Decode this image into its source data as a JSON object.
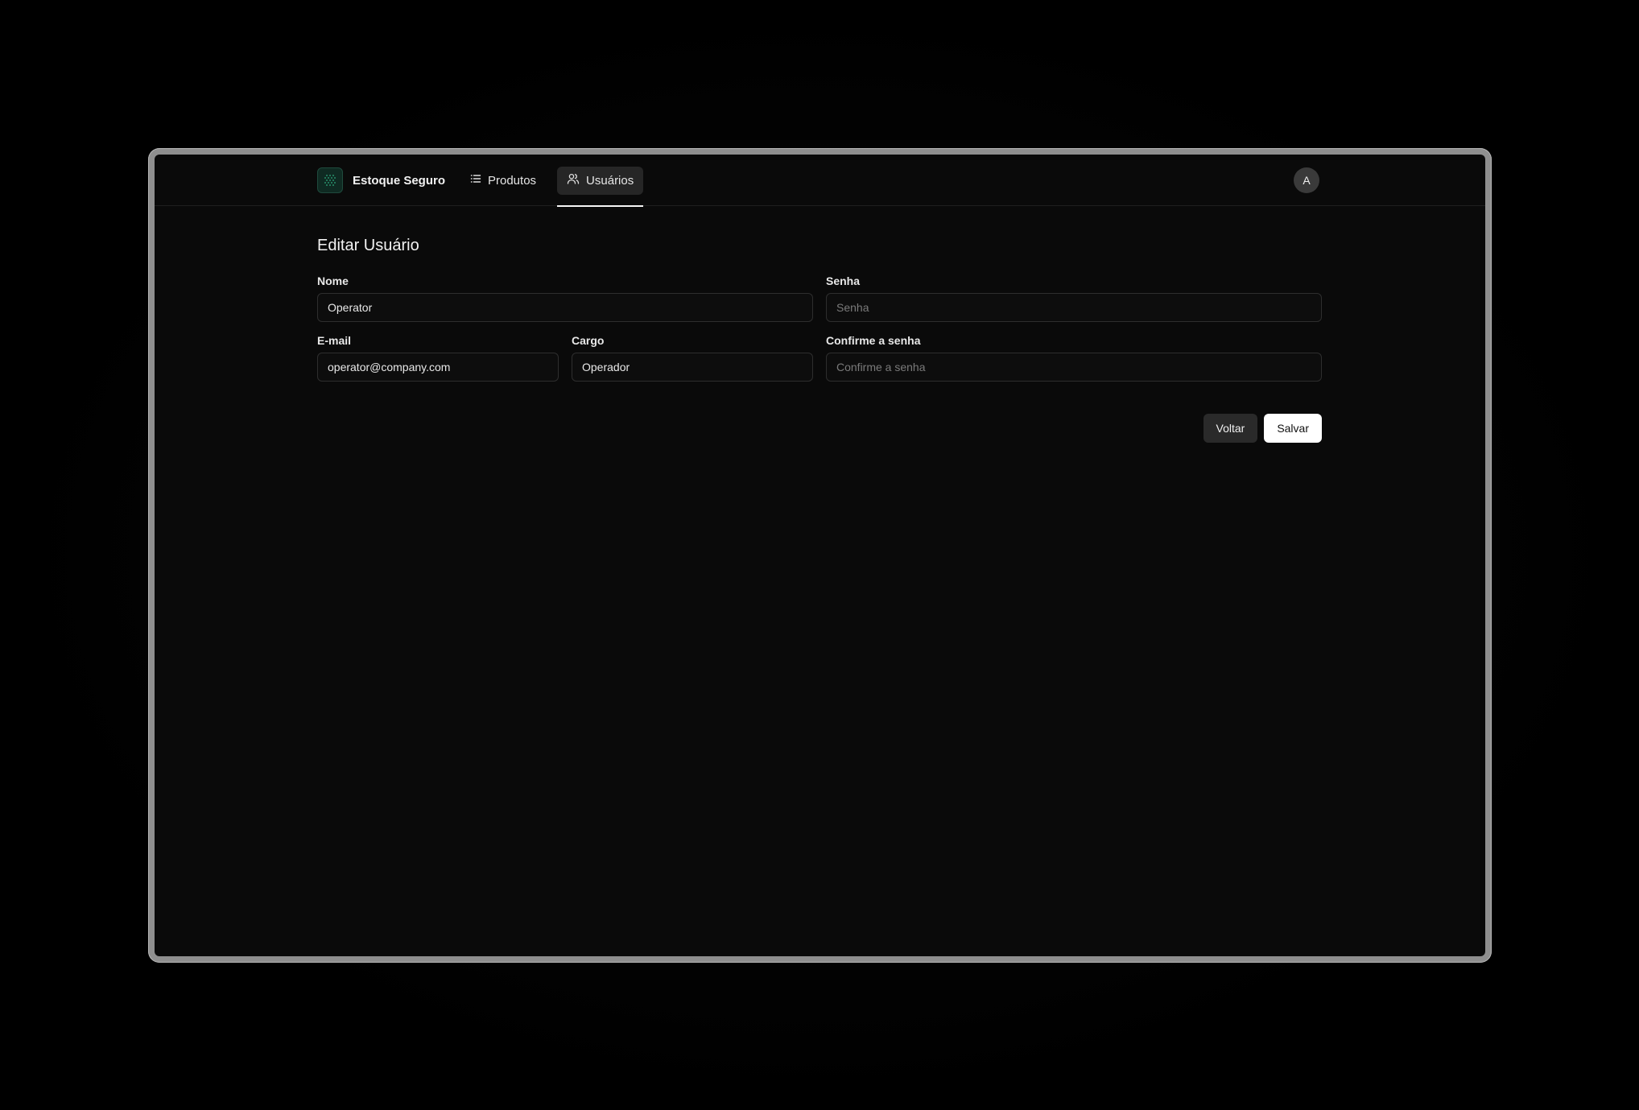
{
  "app": {
    "brand_name": "Estoque Seguro"
  },
  "nav": {
    "items": [
      {
        "label": "Produtos",
        "icon": "list-icon",
        "active": false
      },
      {
        "label": "Usuários",
        "icon": "users-icon",
        "active": true
      }
    ]
  },
  "user": {
    "avatar_initial": "A"
  },
  "page": {
    "title": "Editar Usuário"
  },
  "form": {
    "name": {
      "label": "Nome",
      "value": "Operator"
    },
    "password": {
      "label": "Senha",
      "placeholder": "Senha",
      "value": ""
    },
    "email": {
      "label": "E-mail",
      "value": "operator@company.com"
    },
    "role": {
      "label": "Cargo",
      "value": "Operador"
    },
    "confirm_password": {
      "label": "Confirme a senha",
      "placeholder": "Confirme a senha",
      "value": ""
    }
  },
  "actions": {
    "back_label": "Voltar",
    "save_label": "Salvar"
  },
  "colors": {
    "background": "#0a0a0a",
    "accent": "#ffffff",
    "brand_logo": "#0f2a22"
  }
}
